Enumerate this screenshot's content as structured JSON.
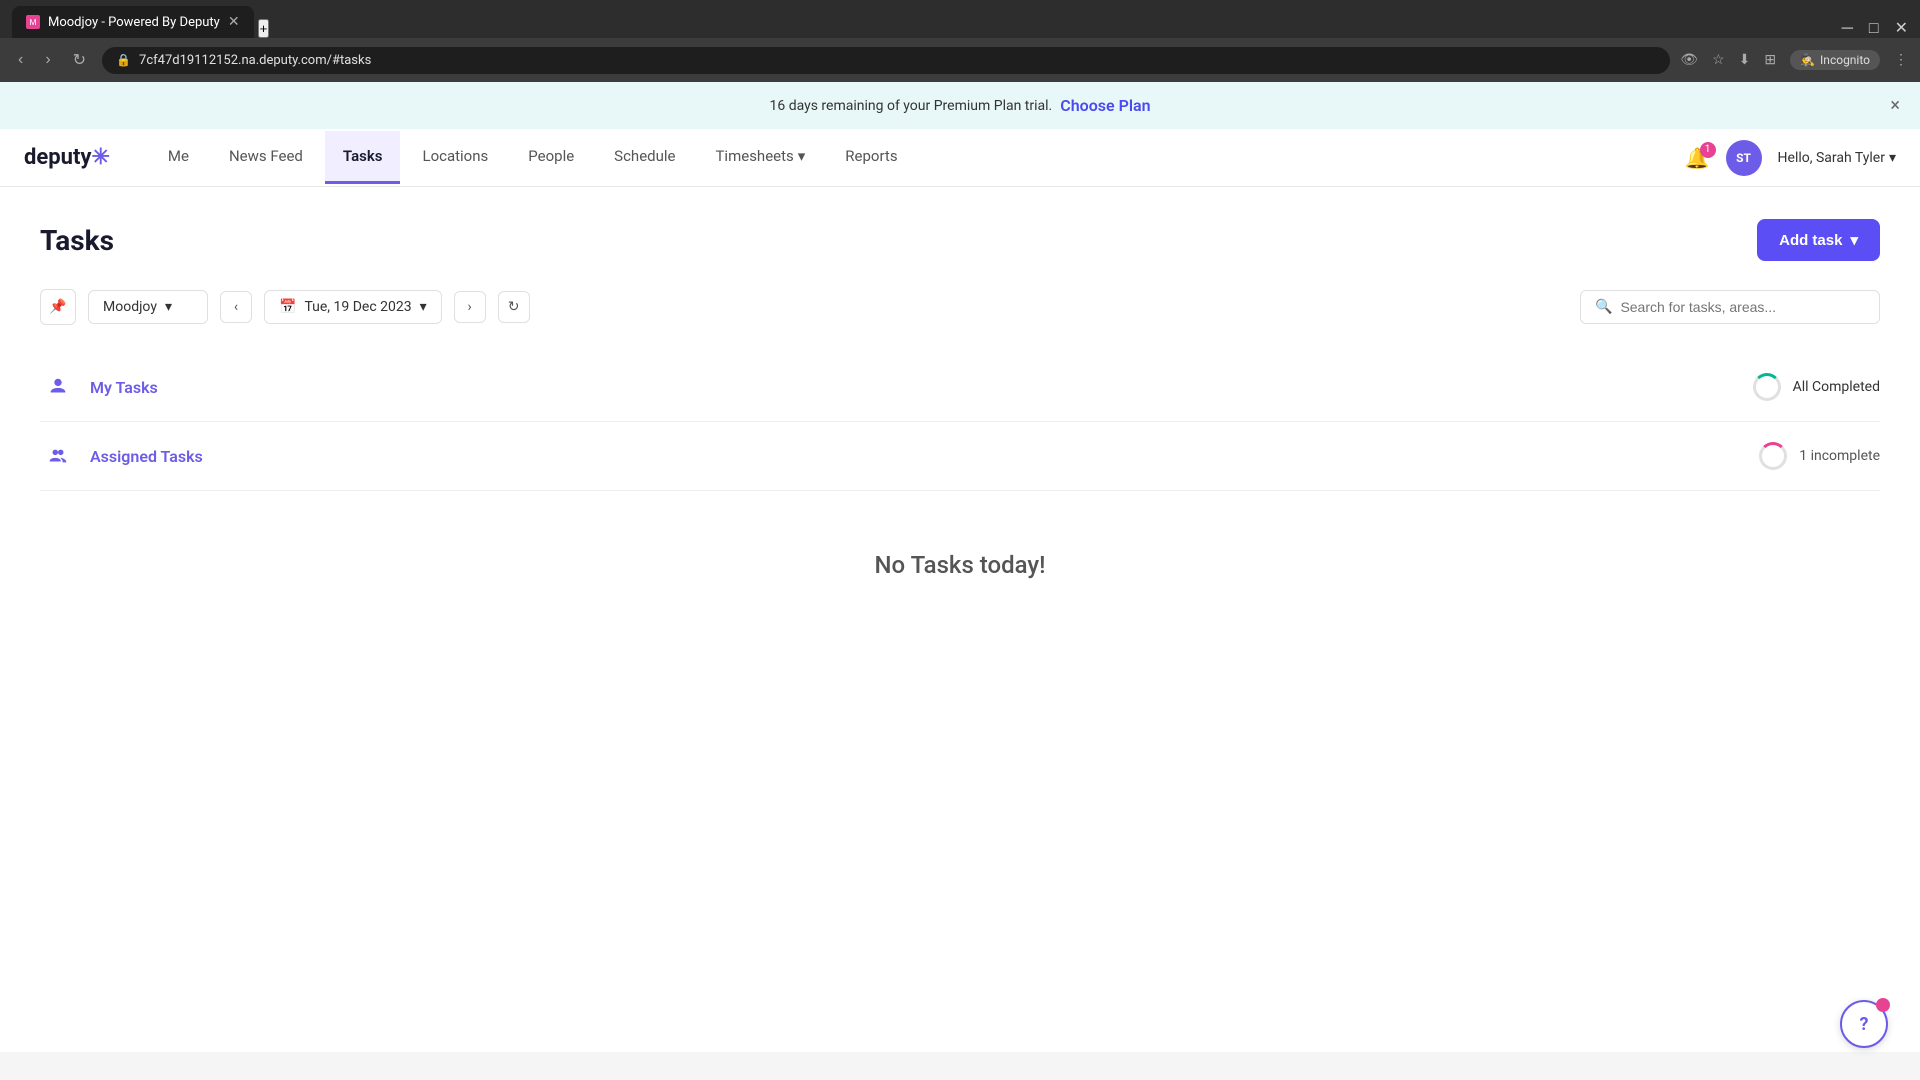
{
  "browser": {
    "tab_title": "Moodjoy - Powered By Deputy",
    "url": "7cf47d19112152.na.deputy.com/#tasks",
    "new_tab_label": "+",
    "incognito_label": "Incognito"
  },
  "banner": {
    "message": "16 days remaining of your Premium Plan trial.",
    "cta": "Choose Plan",
    "close_label": "×"
  },
  "nav": {
    "logo": "deputy",
    "items": [
      {
        "id": "me",
        "label": "Me",
        "active": false
      },
      {
        "id": "news-feed",
        "label": "News Feed",
        "active": false
      },
      {
        "id": "tasks",
        "label": "Tasks",
        "active": true
      },
      {
        "id": "locations",
        "label": "Locations",
        "active": false
      },
      {
        "id": "people",
        "label": "People",
        "active": false
      },
      {
        "id": "schedule",
        "label": "Schedule",
        "active": false
      },
      {
        "id": "timesheets",
        "label": "Timesheets",
        "active": false,
        "dropdown": true
      },
      {
        "id": "reports",
        "label": "Reports",
        "active": false
      }
    ],
    "notification_count": "1",
    "avatar_initials": "ST",
    "greeting": "Hello, Sarah Tyler"
  },
  "page": {
    "title": "Tasks",
    "add_task_label": "Add task"
  },
  "toolbar": {
    "location": "Moodjoy",
    "date": "Tue, 19 Dec 2023",
    "search_placeholder": "Search for tasks, areas..."
  },
  "task_sections": [
    {
      "id": "my-tasks",
      "title": "My Tasks",
      "icon_type": "person",
      "status_label": "All Completed",
      "status_type": "complete"
    },
    {
      "id": "assigned-tasks",
      "title": "Assigned Tasks",
      "icon_type": "group",
      "status_label": "1 incomplete",
      "status_type": "incomplete"
    }
  ],
  "empty_state": {
    "message": "No Tasks today!"
  },
  "help": {
    "label": "?"
  }
}
